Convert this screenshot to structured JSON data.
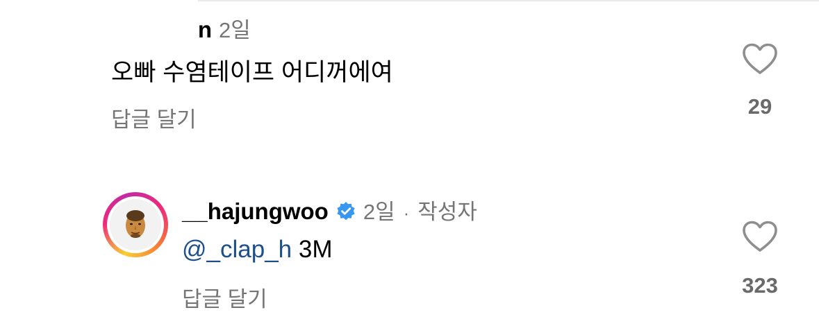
{
  "comments": [
    {
      "username_visible": "n",
      "timestamp": "2일",
      "text": "오빠 수염테이프 어디꺼에여",
      "reply_label": "답글 달기",
      "like_count": "29"
    },
    {
      "username": "__hajungwoo",
      "verified": true,
      "timestamp": "2일",
      "separator": "·",
      "author_tag": "작성자",
      "mention": "@_clap_h",
      "text_after_mention": " 3M",
      "reply_label": "답글 달기",
      "like_count": "323",
      "avatar_icon": "face-avatar"
    }
  ],
  "colors": {
    "mention": "#1d4f8b",
    "secondary_text": "#757575",
    "like_count": "#6a6a6a",
    "verified_badge": "#3897f0",
    "heart_outline": "#8e8e8e"
  },
  "icons": {
    "like": "heart-outline-icon",
    "verified": "verified-badge-icon"
  }
}
